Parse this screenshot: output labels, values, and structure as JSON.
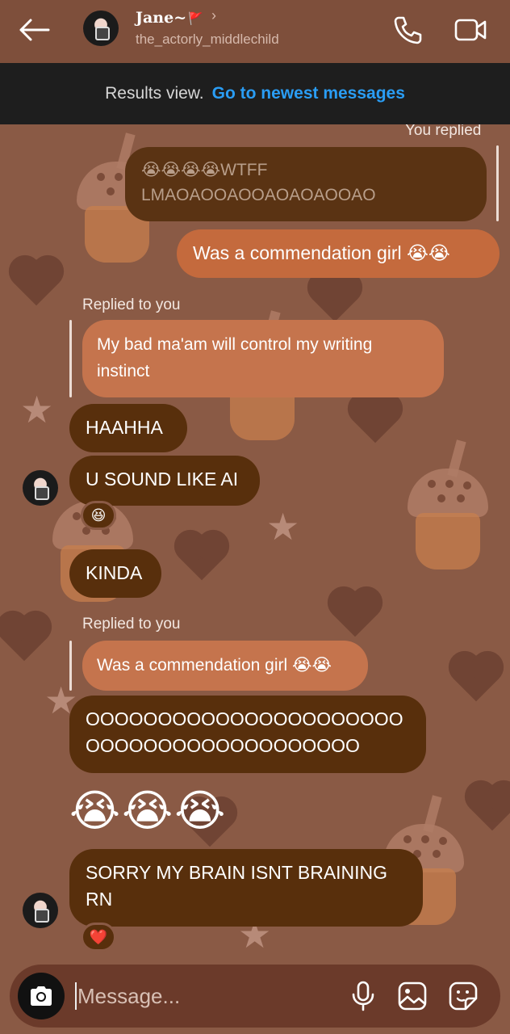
{
  "header": {
    "name": "Jane~",
    "flag": "🚩",
    "chevron": "›",
    "username": "the_actorly_middlechild",
    "icons": [
      "back-arrow-icon",
      "phone-icon",
      "video-camera-icon"
    ]
  },
  "banner": {
    "text": "Results view.",
    "link": "Go to newest messages"
  },
  "messages": {
    "you_replied_label": "You replied",
    "quote1_line1": "😭😭😭😭WTFF",
    "quote1_line2": "LMAOAOOAOOAOAOAOOAO",
    "sent1": "Was a commendation girl 😭😭",
    "replied_to_you_1": "Replied to you",
    "quote2": "My bad ma'am will control my writing instinct",
    "recv_haahha": "HAAHHA",
    "recv_ai": "U SOUND LIKE AI",
    "reaction_1": "😆",
    "recv_kinda": "KINDA",
    "replied_to_you_2": "Replied to you",
    "quote3": "Was a commendation girl 😭😭",
    "recv_ooo": "OOOOOOOOOOOOOOOOOOOOOO OOOOOOOOOOOOOOOOOOO",
    "recv_emojis": "😭😭😭",
    "recv_sorry": "SORRY MY BRAIN ISNT BRAINING RN",
    "reaction_2": "❤️"
  },
  "composer": {
    "placeholder": "Message...",
    "icons": [
      "camera-icon",
      "microphone-icon",
      "gallery-icon",
      "sticker-icon"
    ]
  },
  "colors": {
    "background": "#8a5a45",
    "header": "#7e4f3b",
    "banner": "#1e1e1e",
    "link": "#2a9df4",
    "sent_bubble": "#c46a3d",
    "received_bubble": "#582f0c",
    "composer": "#6b3a2a"
  }
}
